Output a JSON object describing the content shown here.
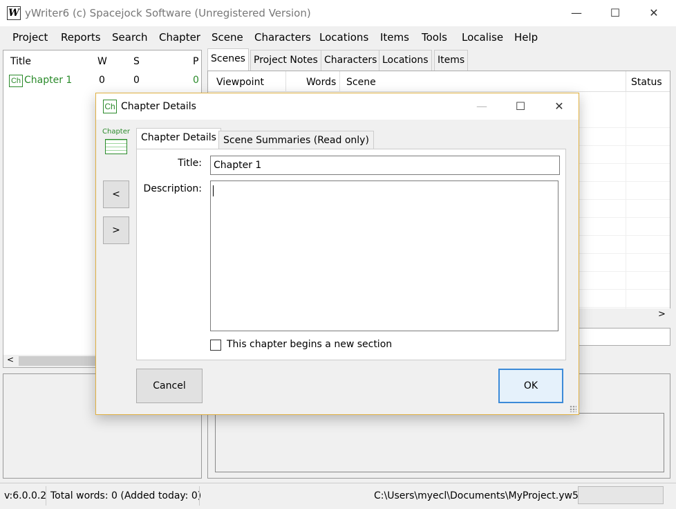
{
  "window": {
    "title": "yWriter6 (c) Spacejock Software (Unregistered Version)",
    "icon_glyph": "W"
  },
  "menu": [
    "Project",
    "Reports",
    "Search",
    "Chapter",
    "Scene",
    "Characters",
    "Locations",
    "Items",
    "Tools",
    "Localise",
    "Help"
  ],
  "left_panel": {
    "columns": [
      "Title",
      "W",
      "S",
      "P"
    ],
    "rows": [
      {
        "icon": "Ch",
        "title": "Chapter 1",
        "w": "0",
        "s": "0",
        "p": "0"
      }
    ]
  },
  "right_panel": {
    "tabs": [
      "Scenes",
      "Project Notes",
      "Characters",
      "Locations",
      "Items"
    ],
    "columns": [
      "Viewpoint",
      "Words",
      "Scene",
      "Status"
    ]
  },
  "status_bar": {
    "version": "v:6.0.0.2",
    "words": "Total words: 0 (Added today: 0)",
    "path": "C:\\Users\\myecl\\Documents\\MyProject.yw5"
  },
  "dialog": {
    "title": "Chapter Details",
    "icon_glyph": "Ch",
    "side_icon_label": "Chapter",
    "prev_label": "<",
    "next_label": ">",
    "tabs": [
      "Chapter Details",
      "Scene Summaries (Read only)"
    ],
    "title_label": "Title:",
    "title_value": "Chapter 1",
    "description_label": "Description:",
    "description_value": "",
    "checkbox_label": "This chapter begins a new section",
    "checkbox_checked": false,
    "cancel_label": "Cancel",
    "ok_label": "OK"
  },
  "colors": {
    "chapter_green": "#2a8a2a",
    "dialog_border": "#e0b040",
    "ok_focus": "#3c8ad8"
  }
}
